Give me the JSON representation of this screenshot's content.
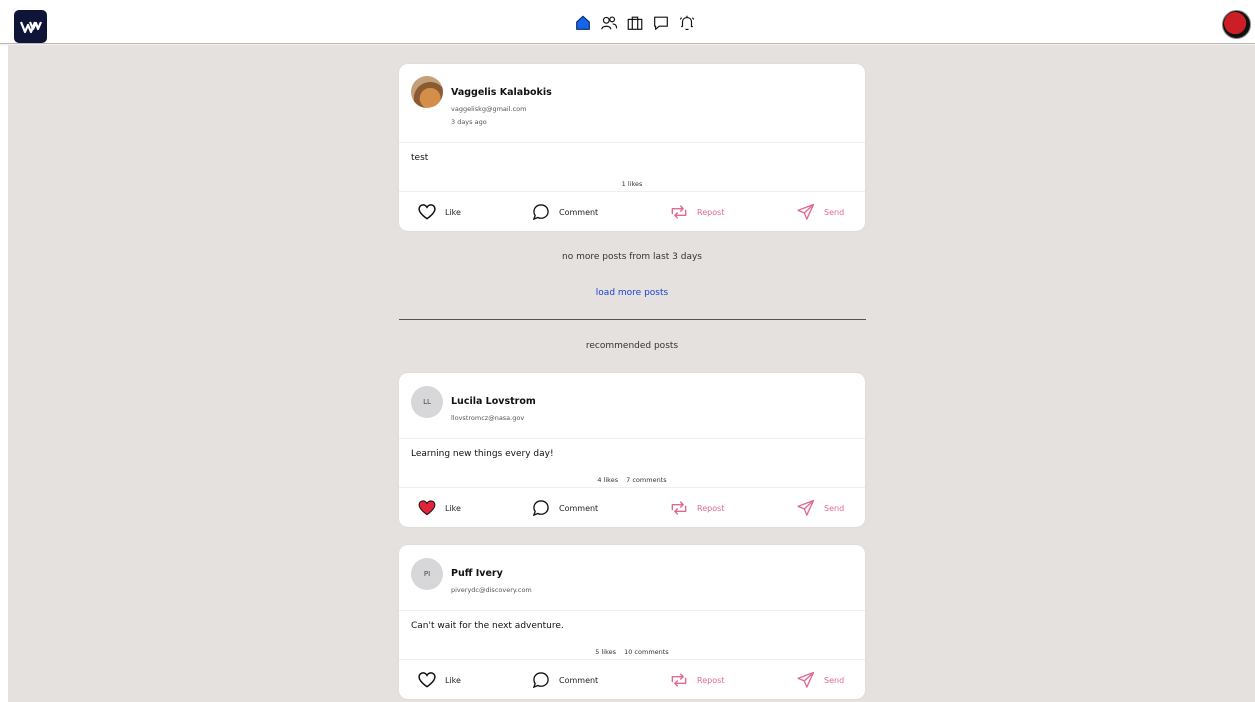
{
  "nav": {
    "logo_text": "W",
    "icons": [
      "home-icon",
      "people-icon",
      "briefcase-icon",
      "chat-icon",
      "bell-icon"
    ]
  },
  "posts": [
    {
      "author": "Vaggelis Kalabokis",
      "email": "vaggeliskg@gmail.com",
      "time": "3 days ago",
      "text": "test",
      "likes": "1 likes",
      "comments": ""
    }
  ],
  "feed_status": {
    "no_more": "no more posts from last 3 days",
    "load_more": "load more posts",
    "recommended_heading": "recommended posts"
  },
  "recommended": [
    {
      "initials": "LL",
      "author": "Lucila Lovstrom",
      "email": "llovstromcz@nasa.gov",
      "text": "Learning new things every day!",
      "likes": "4 likes",
      "comments": "7 comments",
      "liked": true
    },
    {
      "initials": "PI",
      "author": "Puff Ivery",
      "email": "piverydc@discovery.com",
      "text": "Can't wait for the next adventure.",
      "likes": "5 likes",
      "comments": "10 comments",
      "liked": false
    }
  ],
  "actions": {
    "like": "Like",
    "comment": "Comment",
    "repost": "Repost",
    "send": "Send"
  },
  "colors": {
    "feed_bg": "#e5e1df",
    "accent_pink": "#e06a8f",
    "liked_red": "#e0243a",
    "link_blue": "#1a3fd6",
    "logo_bg": "#0f1538"
  }
}
